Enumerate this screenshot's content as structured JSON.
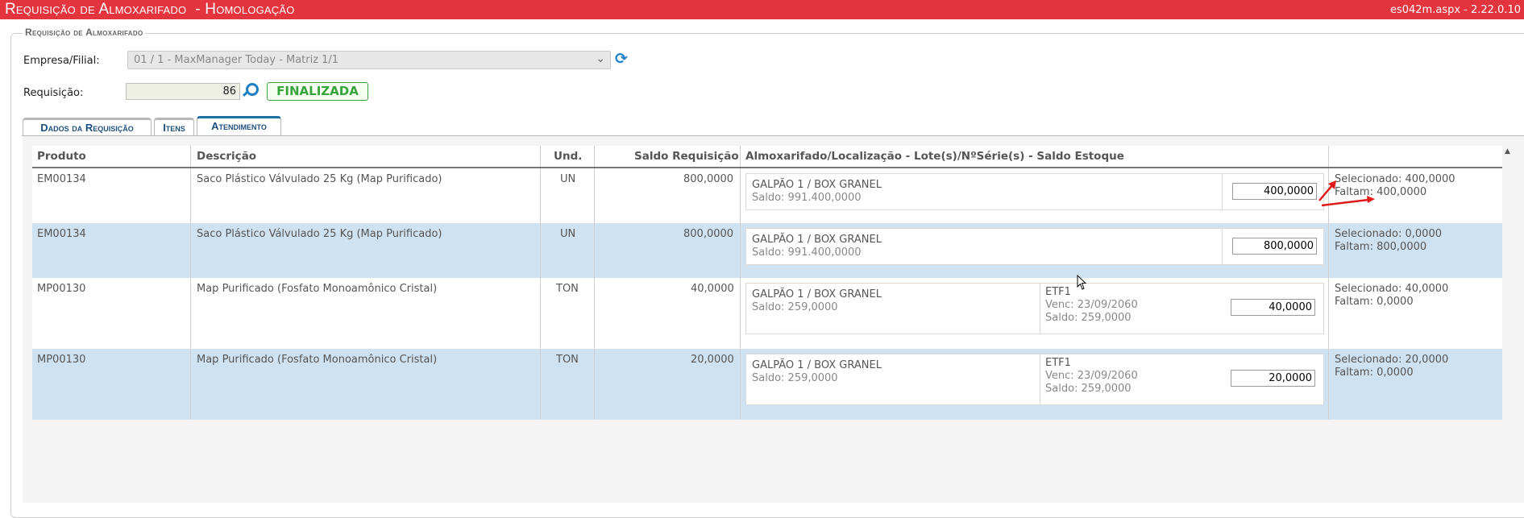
{
  "window": {
    "title": "Requisição de Almoxarifado  - Homologação",
    "version": "es042m.aspx - 2.22.0.10"
  },
  "form": {
    "legend": "Requisição de Almoxarifado",
    "empresa_label": "Empresa/Filial:",
    "empresa_value": "01 / 1 - MaxManager Today - Matriz 1/1",
    "requisicao_label": "Requisição:",
    "requisicao_value": "86",
    "status_badge": "FINALIZADA"
  },
  "tabs": [
    {
      "label": "Dados da Requisição"
    },
    {
      "label": "Itens"
    },
    {
      "label": "Atendimento"
    }
  ],
  "table": {
    "headers": {
      "produto": "Produto",
      "descricao": "Descrição",
      "und": "Und.",
      "saldo": "Saldo Requisição",
      "almox": "Almoxarifado/Localização - Lote(s)/NºSérie(s) - Saldo Estoque"
    },
    "rows": [
      {
        "produto": "EM00134",
        "descricao": "Saco Plástico Válvulado 25 Kg (Map Purificado)",
        "und": "UN",
        "saldo": "800,0000",
        "local": "GALPÃO 1 / BOX GRANEL",
        "local_saldo": "Saldo: 991.400,0000",
        "qty": "400,0000",
        "selecionado": "Selecionado: 400,0000",
        "faltam": "Faltam: 400,0000"
      },
      {
        "produto": "EM00134",
        "descricao": "Saco Plástico Válvulado 25 Kg (Map Purificado)",
        "und": "UN",
        "saldo": "800,0000",
        "local": "GALPÃO 1 / BOX GRANEL",
        "local_saldo": "Saldo: 991.400,0000",
        "qty": "800,0000",
        "selecionado": "Selecionado: 0,0000",
        "faltam": "Faltam: 800,0000"
      },
      {
        "produto": "MP00130",
        "descricao": "Map Purificado (Fosfato Monoamônico Cristal)",
        "und": "TON",
        "saldo": "40,0000",
        "local": "GALPÃO 1 / BOX GRANEL",
        "local_saldo": "Saldo: 259,0000",
        "lote": "ETF1",
        "lote_venc": "Venc: 23/09/2060",
        "lote_saldo": "Saldo: 259,0000",
        "qty": "40,0000",
        "selecionado": "Selecionado: 40,0000",
        "faltam": "Faltam: 0,0000"
      },
      {
        "produto": "MP00130",
        "descricao": "Map Purificado (Fosfato Monoamônico Cristal)",
        "und": "TON",
        "saldo": "20,0000",
        "local": "GALPÃO 1 / BOX GRANEL",
        "local_saldo": "Saldo: 259,0000",
        "lote": "ETF1",
        "lote_venc": "Venc: 23/09/2060",
        "lote_saldo": "Saldo: 259,0000",
        "qty": "20,0000",
        "selecionado": "Selecionado: 20,0000",
        "faltam": "Faltam: 0,0000"
      }
    ]
  },
  "icons": {
    "refresh": "refresh-icon",
    "search": "search-icon",
    "dropdown": "chevron-down-icon",
    "annotation": "red-arrow-icon"
  },
  "colors": {
    "titlebar": "#e4343d",
    "finalizada": "#37a33b",
    "row_highlight": "#cfe2f2",
    "annotation_arrow": "#e01a1a"
  }
}
